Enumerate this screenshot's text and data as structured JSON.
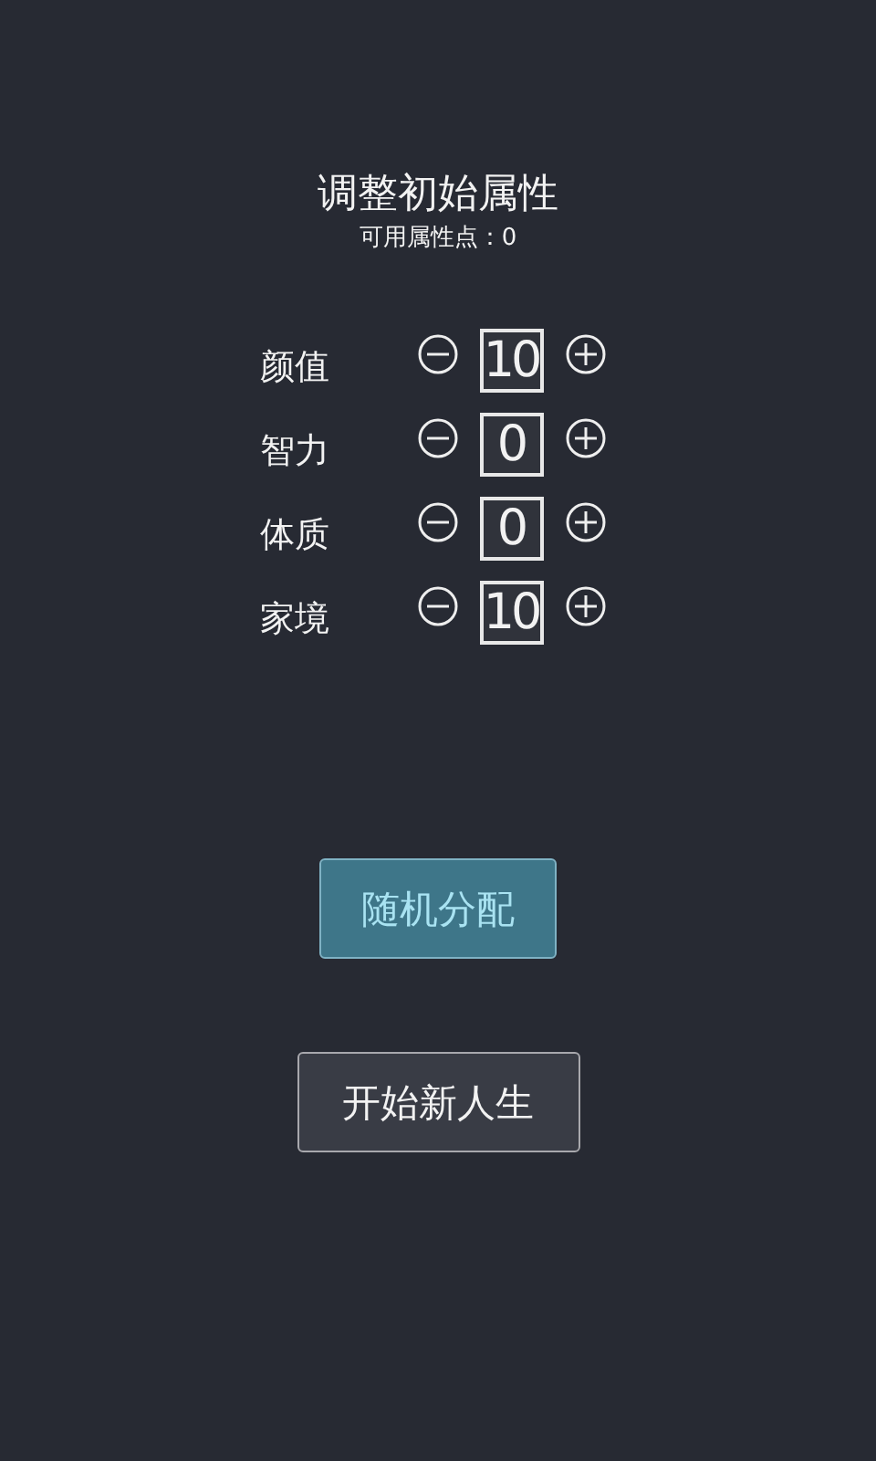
{
  "title": "调整初始属性",
  "points": {
    "label": "可用属性点：",
    "value": "0"
  },
  "attributes": [
    {
      "name": "颜值",
      "value": "10"
    },
    {
      "name": "智力",
      "value": "0"
    },
    {
      "name": "体质",
      "value": "0"
    },
    {
      "name": "家境",
      "value": "10"
    }
  ],
  "buttons": [
    {
      "label": "随机分配",
      "kind": "accent"
    },
    {
      "label": "开始新人生",
      "kind": "plain"
    }
  ]
}
